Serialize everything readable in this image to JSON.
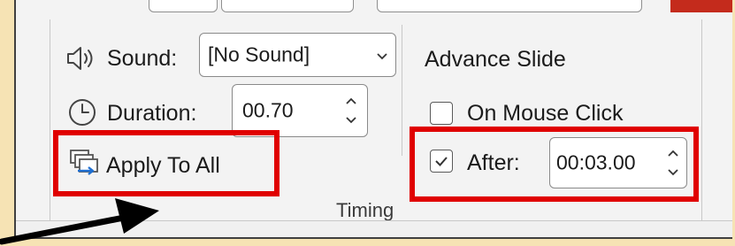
{
  "timing": {
    "sound_label": "Sound:",
    "sound_value": "[No Sound]",
    "duration_label": "Duration:",
    "duration_value": "00.70",
    "apply_to_all_label": "Apply To All",
    "group_label": "Timing"
  },
  "advance_slide": {
    "heading": "Advance Slide",
    "on_mouse_click_label": "On Mouse Click",
    "on_mouse_click_checked": false,
    "after_label": "After:",
    "after_checked": true,
    "after_value": "00:03.00"
  },
  "annotations": {
    "highlight_color": "#e00000",
    "arrow_color": "#000000",
    "highlighted_items": [
      "apply-to-all-button",
      "after-setting"
    ]
  },
  "icons": {
    "sound": "speaker-icon",
    "duration": "clock-icon",
    "apply_to_all": "apply-to-all-icon",
    "sound_dropdown": "chevron-down-icon",
    "spinner": "spin-up-down-icon"
  }
}
